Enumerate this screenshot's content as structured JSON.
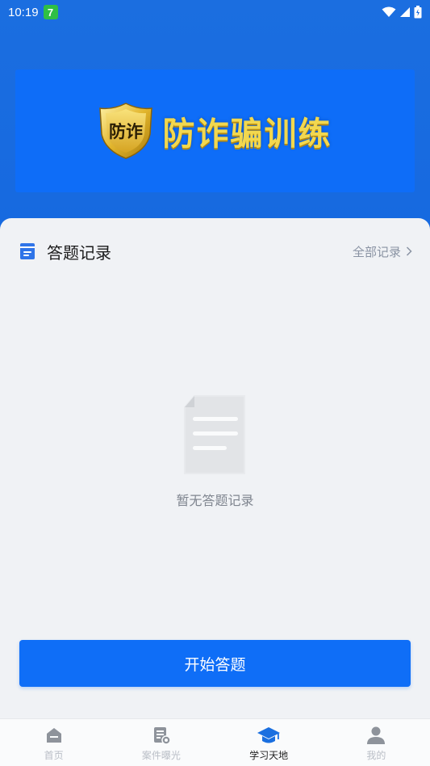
{
  "status_bar": {
    "time": "10:19",
    "notification_badge": "7"
  },
  "banner": {
    "shield_text": "防诈",
    "title": "防诈骗训练"
  },
  "records": {
    "title": "答题记录",
    "all_records_link": "全部记录",
    "empty_message": "暂无答题记录"
  },
  "start_button": {
    "label": "开始答题"
  },
  "tabbar": {
    "items": [
      {
        "label": "首页",
        "icon": "home-icon",
        "active": false
      },
      {
        "label": "案件曝光",
        "icon": "case-exposure-icon",
        "active": false
      },
      {
        "label": "学习天地",
        "icon": "graduation-cap-icon",
        "active": true
      },
      {
        "label": "我的",
        "icon": "user-icon",
        "active": false
      }
    ]
  },
  "colors": {
    "primary": "#0f6ef7",
    "header_bg": "#1b6ee0",
    "banner_title": "#f2d84f",
    "tab_active": "#1a6fe0",
    "tab_inactive": "#b9bec6"
  }
}
